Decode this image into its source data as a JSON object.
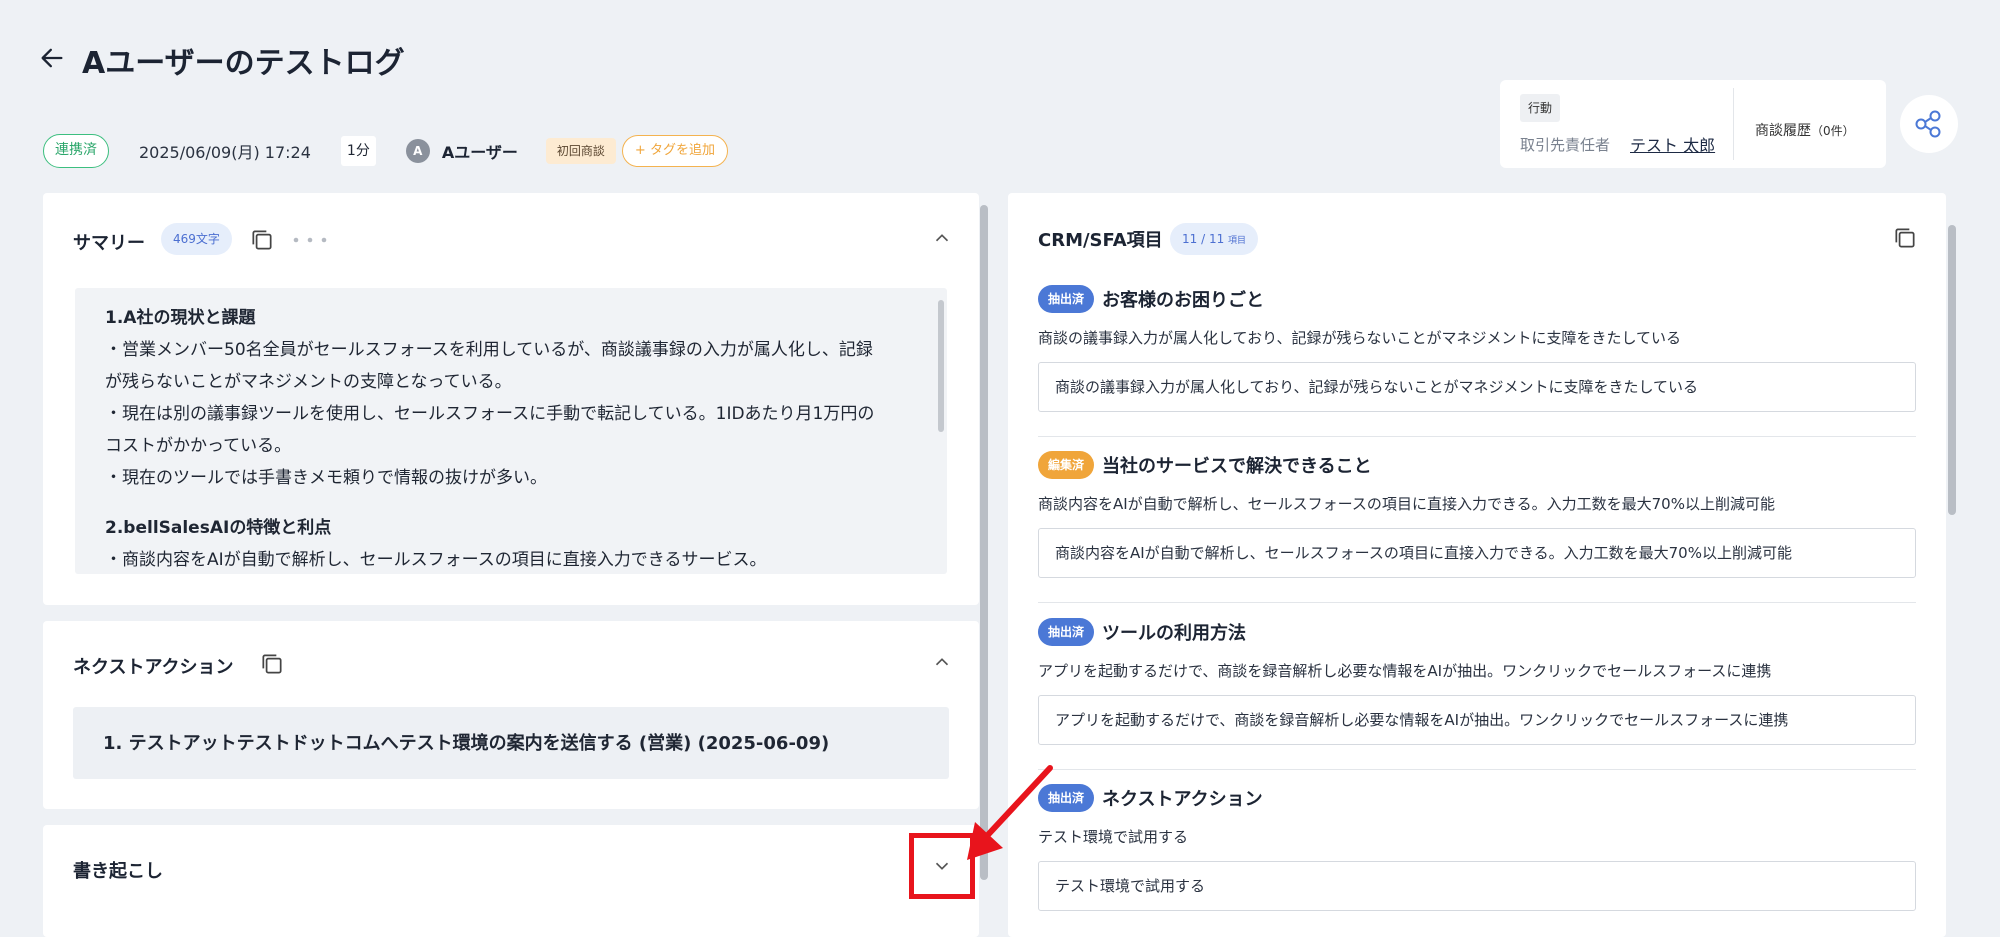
{
  "header": {
    "title": "Aユーザーのテストログ"
  },
  "meta": {
    "status": "連携済",
    "datetime": "2025/06/09(月) 17:24",
    "duration": "1分",
    "avatar_initial": "A",
    "user": "Aユーザー",
    "tag": "初回商談",
    "add_tag": "タグを追加"
  },
  "info": {
    "action_label": "行動",
    "owner_label": "取引先責任者",
    "owner_name": "テスト 太郎",
    "history": "商談履歴",
    "history_count": "（0件）"
  },
  "summary": {
    "title": "サマリー",
    "char_count": "469文字",
    "lines": [
      {
        "text": "1.A社の現状と課題",
        "bold": true
      },
      {
        "text": "・営業メンバー50名全員がセールスフォースを利用しているが、商談議事録の入力が属人化し、記録",
        "bold": false
      },
      {
        "text": "が残らないことがマネジメントの支障となっている。",
        "bold": false
      },
      {
        "text": "・現在は別の議事録ツールを使用し、セールスフォースに手動で転記している。1IDあたり月1万円の",
        "bold": false
      },
      {
        "text": "コストがかかっている。",
        "bold": false
      },
      {
        "text": "・現在のツールでは手書きメモ頼りで情報の抜けが多い。",
        "bold": false
      },
      {
        "text": "",
        "bold": false
      },
      {
        "text": "2.bellSalesAIの特徴と利点",
        "bold": true
      },
      {
        "text": "・商談内容をAIが自動で解析し、セールスフォースの項目に直接入力できるサービス。",
        "bold": false
      }
    ]
  },
  "next_action": {
    "title": "ネクストアクション",
    "item": "1. テストアットテストドットコムへテスト環境の案内を送信する (営業) (2025-06-09)"
  },
  "transcript": {
    "title": "書き起こし"
  },
  "crm": {
    "title": "CRM/SFA項目",
    "count": "11 / 11",
    "count_unit": "項目",
    "sections": [
      {
        "badge": "抽出済",
        "badge_type": "extract",
        "heading": "お客様のお困りごと",
        "description": "商談の議事録入力が属人化しており、記録が残らないことがマネジメントに支障をきたしている",
        "value": "商談の議事録入力が属人化しており、記録が残らないことがマネジメントに支障をきたしている"
      },
      {
        "badge": "編集済",
        "badge_type": "edit",
        "heading": "当社のサービスで解決できること",
        "description": "商談内容をAIが自動で解析し、セールスフォースの項目に直接入力できる。入力工数を最大70%以上削減可能",
        "value": "商談内容をAIが自動で解析し、セールスフォースの項目に直接入力できる。入力工数を最大70%以上削減可能"
      },
      {
        "badge": "抽出済",
        "badge_type": "extract",
        "heading": "ツールの利用方法",
        "description": "アプリを起動するだけで、商談を録音解析し必要な情報をAIが抽出。ワンクリックでセールスフォースに連携",
        "value": "アプリを起動するだけで、商談を録音解析し必要な情報をAIが抽出。ワンクリックでセールスフォースに連携"
      },
      {
        "badge": "抽出済",
        "badge_type": "extract",
        "heading": "ネクストアクション",
        "description": "テスト環境で試用する",
        "value": "テスト環境で試用する"
      }
    ]
  },
  "colors": {
    "accent_blue": "#4b78d6",
    "edited_orange": "#f0a53a",
    "linked_green": "#2aa66a",
    "annotation_red": "#e8141c"
  },
  "icons": [
    "back-arrow-icon",
    "copy-icon",
    "more-dots-icon",
    "chevron-up-icon",
    "chevron-down-icon",
    "share-icon",
    "plus-icon"
  ]
}
